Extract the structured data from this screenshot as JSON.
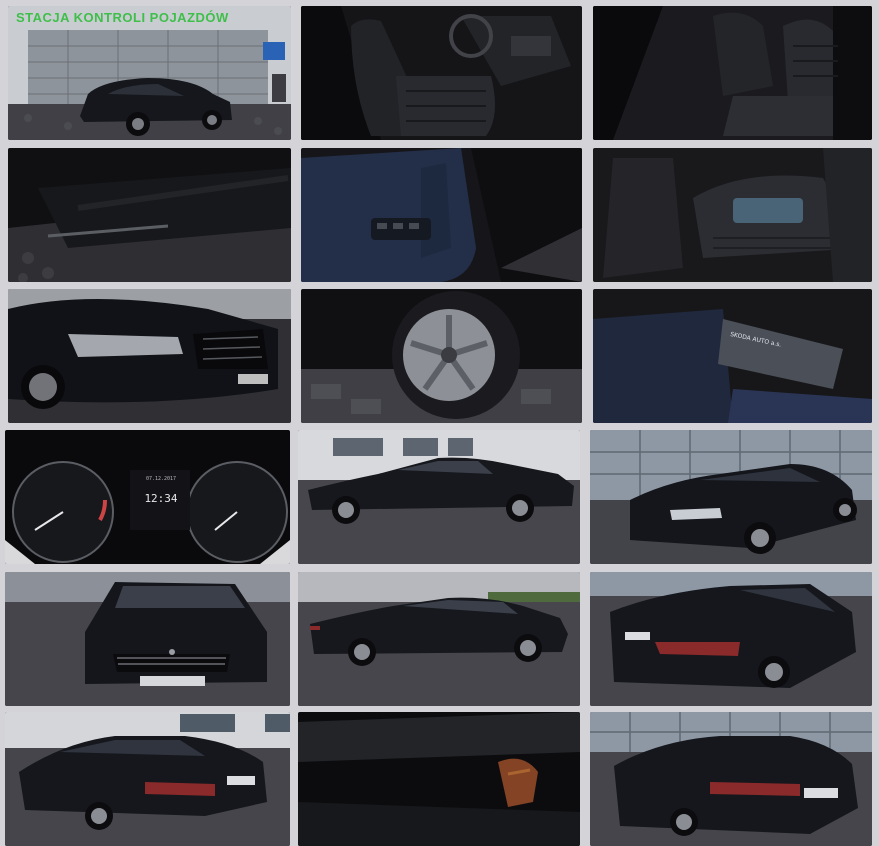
{
  "gallery": {
    "station_sign": "STACJA KONTROLI POJAZDÓW",
    "dashboard": {
      "date": "07.12.2017",
      "time": "12:34"
    },
    "service_tag": "SKODA AUTO a.s.",
    "colors": {
      "car_body": "#14161c",
      "cobblestone": "#3b3b40",
      "background": "#d4d4d8",
      "sign_text": "#3fbf4a"
    }
  }
}
